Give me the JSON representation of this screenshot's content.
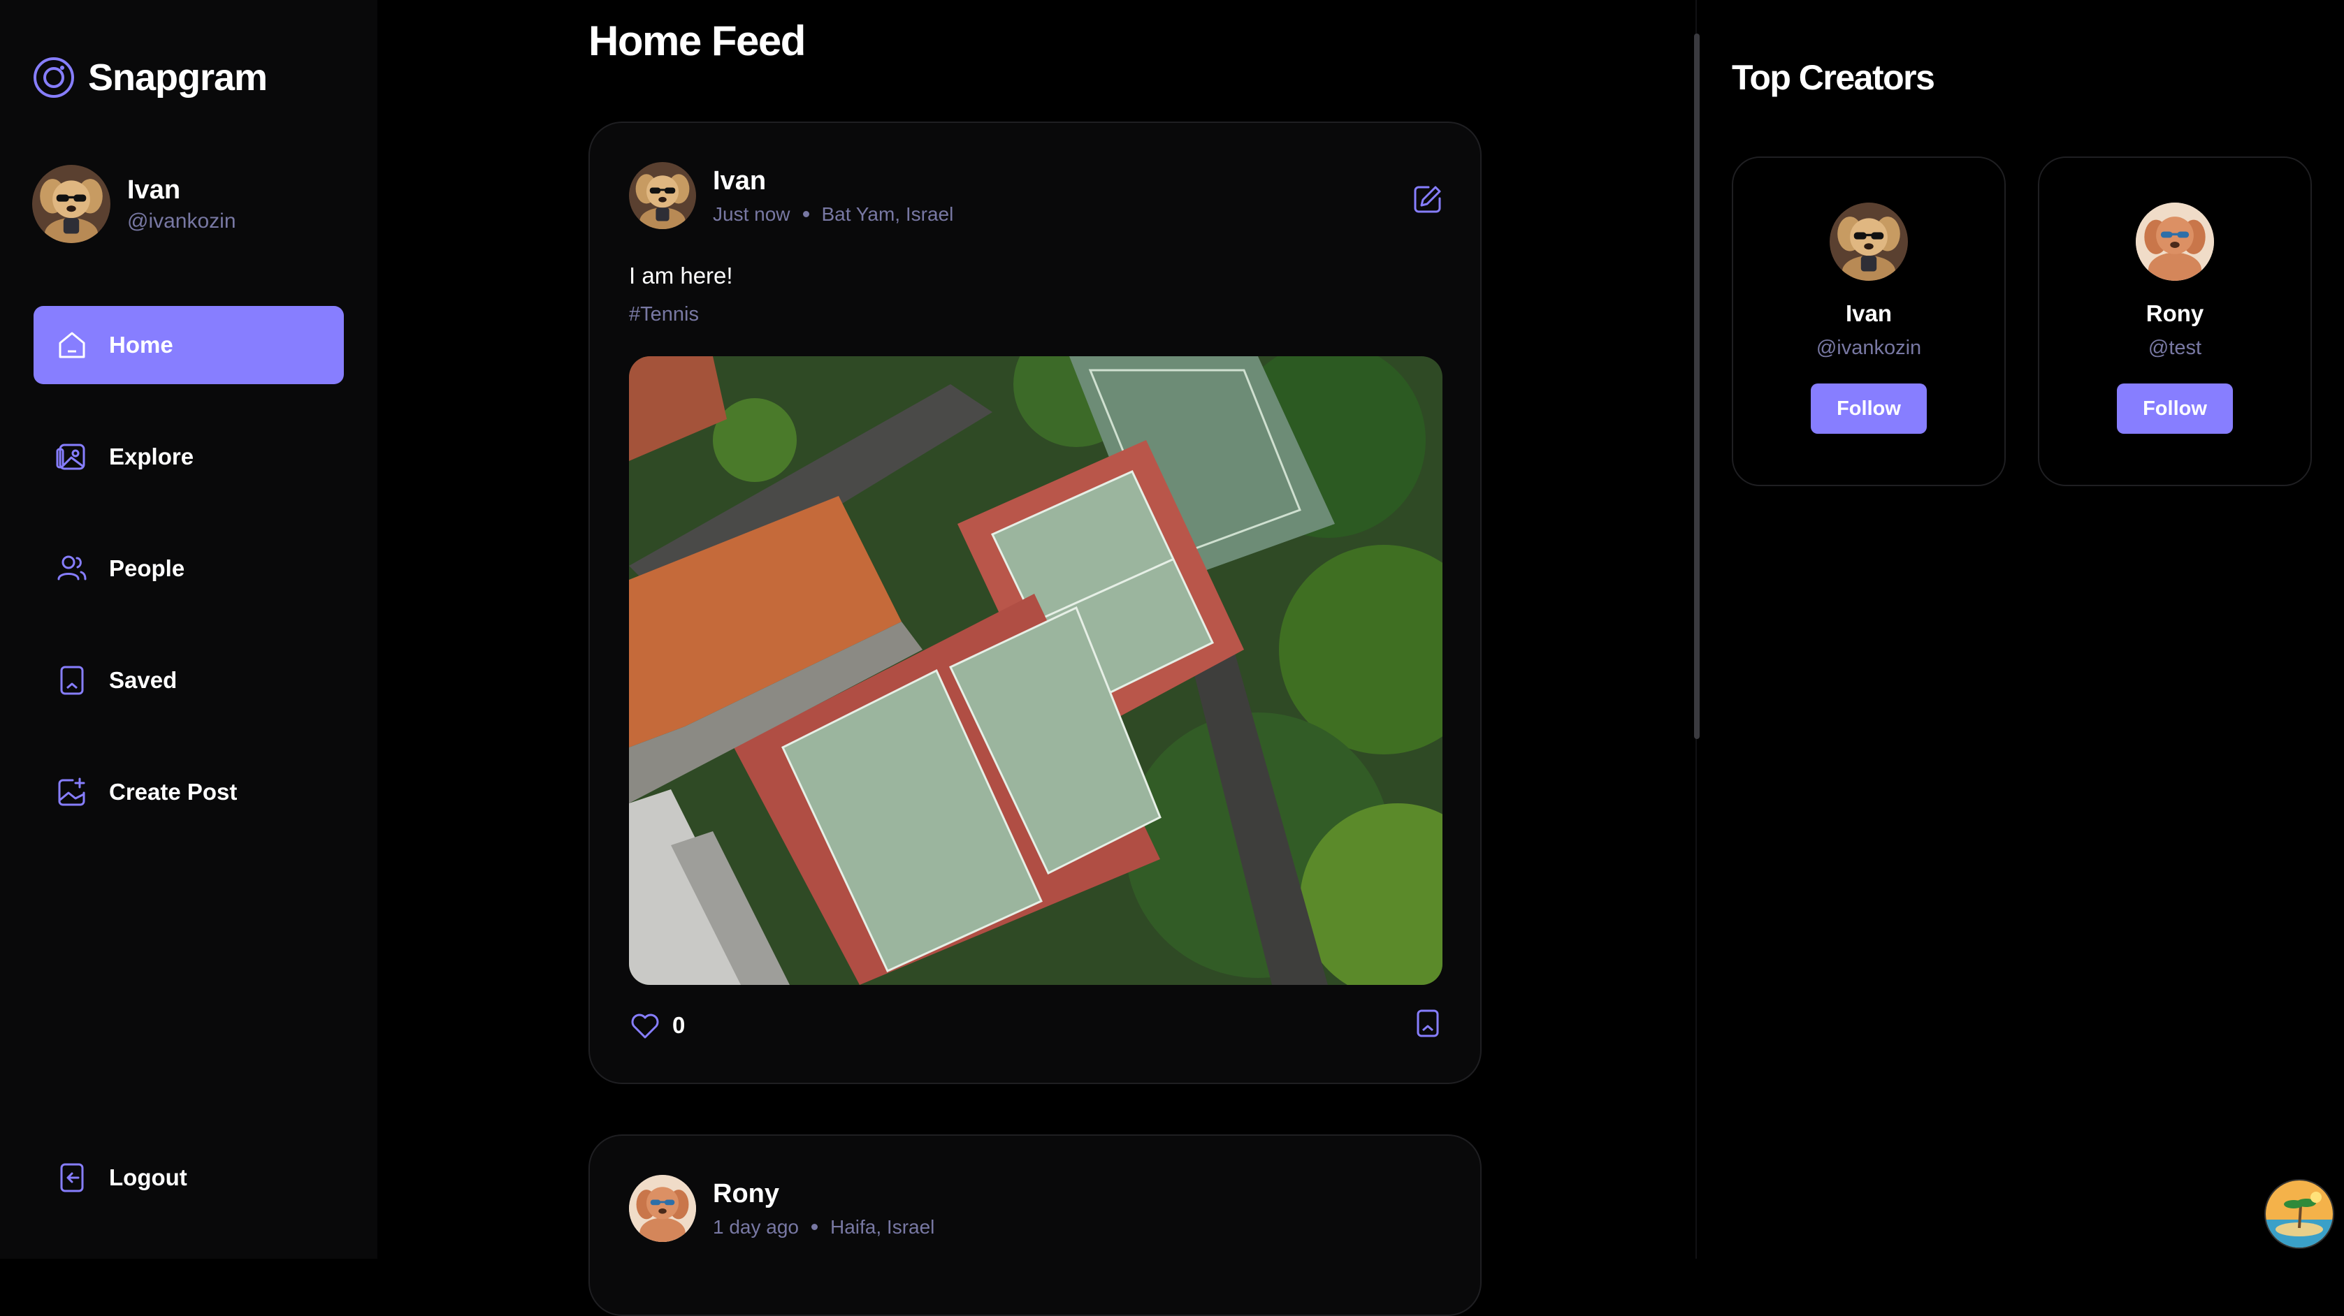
{
  "app": {
    "name": "Snapgram"
  },
  "user": {
    "name": "Ivan",
    "handle": "@ivankozin"
  },
  "nav": [
    {
      "label": "Home",
      "icon": "home-icon",
      "active": true
    },
    {
      "label": "Explore",
      "icon": "explore-icon",
      "active": false
    },
    {
      "label": "People",
      "icon": "people-icon",
      "active": false
    },
    {
      "label": "Saved",
      "icon": "bookmark-icon",
      "active": false
    },
    {
      "label": "Create Post",
      "icon": "create-post-icon",
      "active": false
    }
  ],
  "logout": {
    "label": "Logout"
  },
  "feed": {
    "title": "Home Feed",
    "posts": [
      {
        "author": "Ivan",
        "time": "Just now",
        "location": "Bat Yam, Israel",
        "caption": "I am here!",
        "tag": "#Tennis",
        "likes": "0",
        "image": "aerial-tennis-courts-photo"
      },
      {
        "author": "Rony",
        "time": "1 day ago",
        "location": "Haifa, Israel"
      }
    ]
  },
  "right_panel": {
    "title": "Top Creators",
    "creators": [
      {
        "name": "Ivan",
        "handle": "@ivankozin",
        "button": "Follow"
      },
      {
        "name": "Rony",
        "handle": "@test",
        "button": "Follow"
      }
    ]
  },
  "colors": {
    "accent": "#877eff",
    "muted": "#7878a3",
    "card": "#09090a"
  }
}
